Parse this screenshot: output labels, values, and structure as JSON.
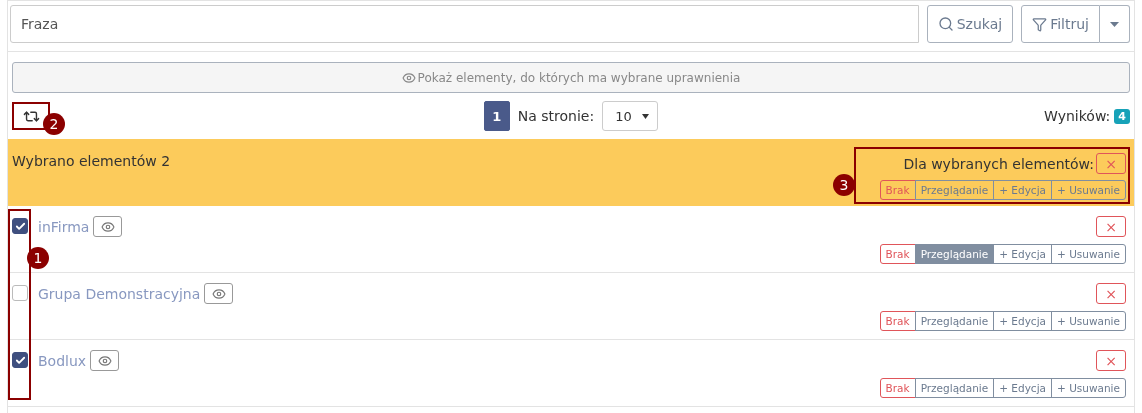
{
  "search": {
    "placeholder": "Fraza",
    "search_button": "Szukaj",
    "filter_button": "Filtruj"
  },
  "show_button": "Pokaż elementy, do których ma wybrane uprawnienia",
  "pagination": {
    "pages": [
      {
        "label": "1",
        "selected": true
      }
    ],
    "per_page_label": "Na stronie:",
    "per_page": "10",
    "results_label": "Wyników:",
    "results": "4"
  },
  "selection_bar": {
    "text": "Wybrano elementów 2",
    "bulk_label": "Dla wybranych elementów:",
    "remove": "×",
    "options": [
      {
        "label": "Brak",
        "kind": "none",
        "selected": false
      },
      {
        "label": "Przeglądanie",
        "kind": "grant",
        "selected": false
      },
      {
        "label": "+ Edycja",
        "kind": "grant",
        "selected": false
      },
      {
        "label": "+ Usuwanie",
        "kind": "grant",
        "selected": false
      }
    ]
  },
  "rows": [
    {
      "name": "inFirma",
      "checked": true,
      "remove": "×",
      "options": [
        {
          "label": "Brak",
          "kind": "none",
          "selected": false
        },
        {
          "label": "Przeglądanie",
          "kind": "grant",
          "selected": true
        },
        {
          "label": "+ Edycja",
          "kind": "grant",
          "selected": false
        },
        {
          "label": "+ Usuwanie",
          "kind": "grant",
          "selected": false
        }
      ]
    },
    {
      "name": "Grupa Demonstracyjna",
      "checked": false,
      "remove": "×",
      "options": [
        {
          "label": "Brak",
          "kind": "none",
          "selected": false
        },
        {
          "label": "Przeglądanie",
          "kind": "grant",
          "selected": false
        },
        {
          "label": "+ Edycja",
          "kind": "grant",
          "selected": false
        },
        {
          "label": "+ Usuwanie",
          "kind": "grant",
          "selected": false
        }
      ]
    },
    {
      "name": "Bodlux",
      "checked": true,
      "remove": "×",
      "options": [
        {
          "label": "Brak",
          "kind": "none",
          "selected": false
        },
        {
          "label": "Przeglądanie",
          "kind": "grant",
          "selected": false
        },
        {
          "label": "+ Edycja",
          "kind": "grant",
          "selected": false
        },
        {
          "label": "+ Usuwanie",
          "kind": "grant",
          "selected": false
        }
      ]
    }
  ],
  "annotations": [
    "1",
    "2",
    "3"
  ]
}
